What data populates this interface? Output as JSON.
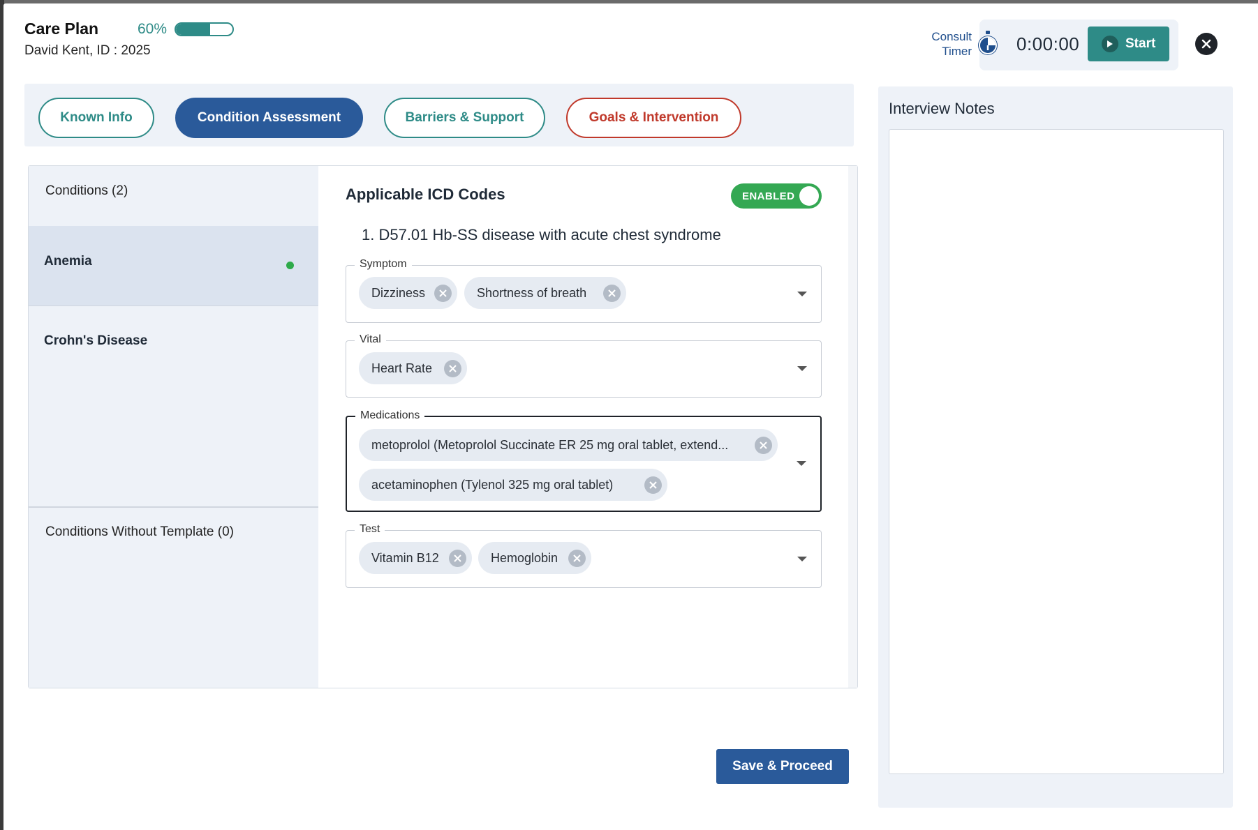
{
  "header": {
    "title": "Care Plan",
    "progress_label": "60%",
    "progress_value": 0.6,
    "patient": "David Kent, ID : 2025"
  },
  "timer": {
    "label": "Consult Timer",
    "value": "0:00:00",
    "start_label": "Start",
    "icon": "stopwatch-icon"
  },
  "tabs": [
    {
      "label": "Known Info"
    },
    {
      "label": "Condition Assessment"
    },
    {
      "label": "Barriers & Support"
    },
    {
      "label": "Goals & Intervention"
    }
  ],
  "conditions": {
    "header": "Conditions (2)",
    "items": [
      {
        "label": "Anemia"
      },
      {
        "label": "Crohn's Disease"
      }
    ],
    "without_template": "Conditions Without Template (0)"
  },
  "icd": {
    "title": "Applicable ICD Codes",
    "toggle_label": "ENABLED",
    "code": "1. D57.01 Hb-SS disease with acute chest syndrome"
  },
  "fields": {
    "symptom": {
      "legend": "Symptom",
      "chips": [
        "Dizziness",
        "Shortness of breath"
      ]
    },
    "vital": {
      "legend": "Vital",
      "chips": [
        "Heart Rate"
      ]
    },
    "medications": {
      "legend": "Medications",
      "chips": [
        "metoprolol (Metoprolol Succinate ER 25 mg oral tablet, extend...",
        "acetaminophen (Tylenol 325 mg oral tablet)"
      ]
    },
    "test": {
      "legend": "Test",
      "chips": [
        "Vitamin B12",
        "Hemoglobin"
      ]
    }
  },
  "actions": {
    "save_label": "Save & Proceed"
  },
  "notes": {
    "title": "Interview Notes",
    "value": ""
  },
  "colors": {
    "teal": "#2e8b87",
    "primary_blue": "#2a5a9a",
    "goals_red": "#c0392b",
    "enabled_green": "#34a853",
    "panel_bg": "#eef2f8"
  }
}
